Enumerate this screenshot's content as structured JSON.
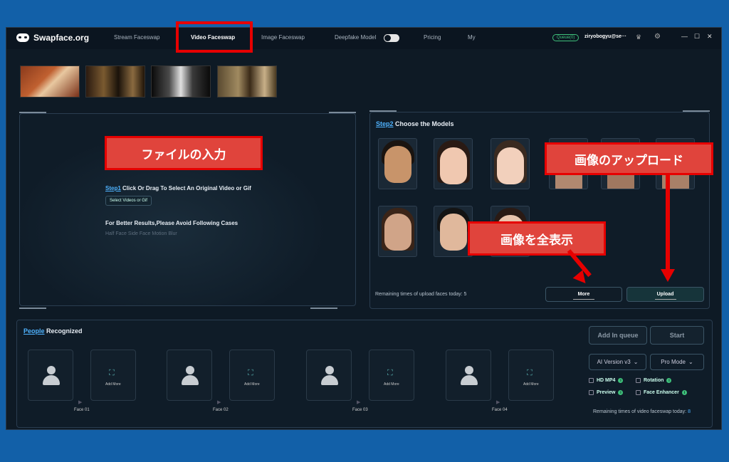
{
  "app": {
    "title": "Swapface.org"
  },
  "nav": [
    "Stream Faceswap",
    "Video Faceswap",
    "Image Faceswap",
    "Deepfake Model",
    "Pricing",
    "My"
  ],
  "user": {
    "queue": "Queue(0)",
    "email": "ziryobogyu@se···"
  },
  "left_panel": {
    "step_prefix": "Step1",
    "step_text": "Click Or Drag To Select An Original Video or Gif",
    "select_button": "Select Videos or Gif",
    "tips_title": "For Better Results,Please Avoid Following Cases",
    "tips": "Half Face  Side Face  Motion Blur"
  },
  "right_panel": {
    "step_prefix": "Step2",
    "step_text": "Choose the Models",
    "remaining": "Remaining times of upload faces today: 5",
    "more_button": "More",
    "upload_button": "Upload"
  },
  "bottom_panel": {
    "title_prefix": "People",
    "title_text": "Recognized",
    "add_more": "Add More",
    "faces": [
      "Face 01",
      "Face 02",
      "Face 03",
      "Face 04"
    ],
    "add_queue": "Add In queue",
    "start": "Start",
    "version": "AI Version v3",
    "mode": "Pro Mode",
    "options": [
      "HD MP4",
      "Rotation",
      "Preview",
      "Face Enhancer"
    ],
    "remaining_prefix": "Remaining times of video faceswap today:",
    "remaining_count": "8"
  },
  "annotations": {
    "file_input": "ファイルの入力",
    "image_upload": "画像のアップロード",
    "show_all": "画像を全表示"
  },
  "colors": {
    "accent": "#3ec07a",
    "annotation_red": "#e60000",
    "link_blue": "#4fb3ff"
  }
}
